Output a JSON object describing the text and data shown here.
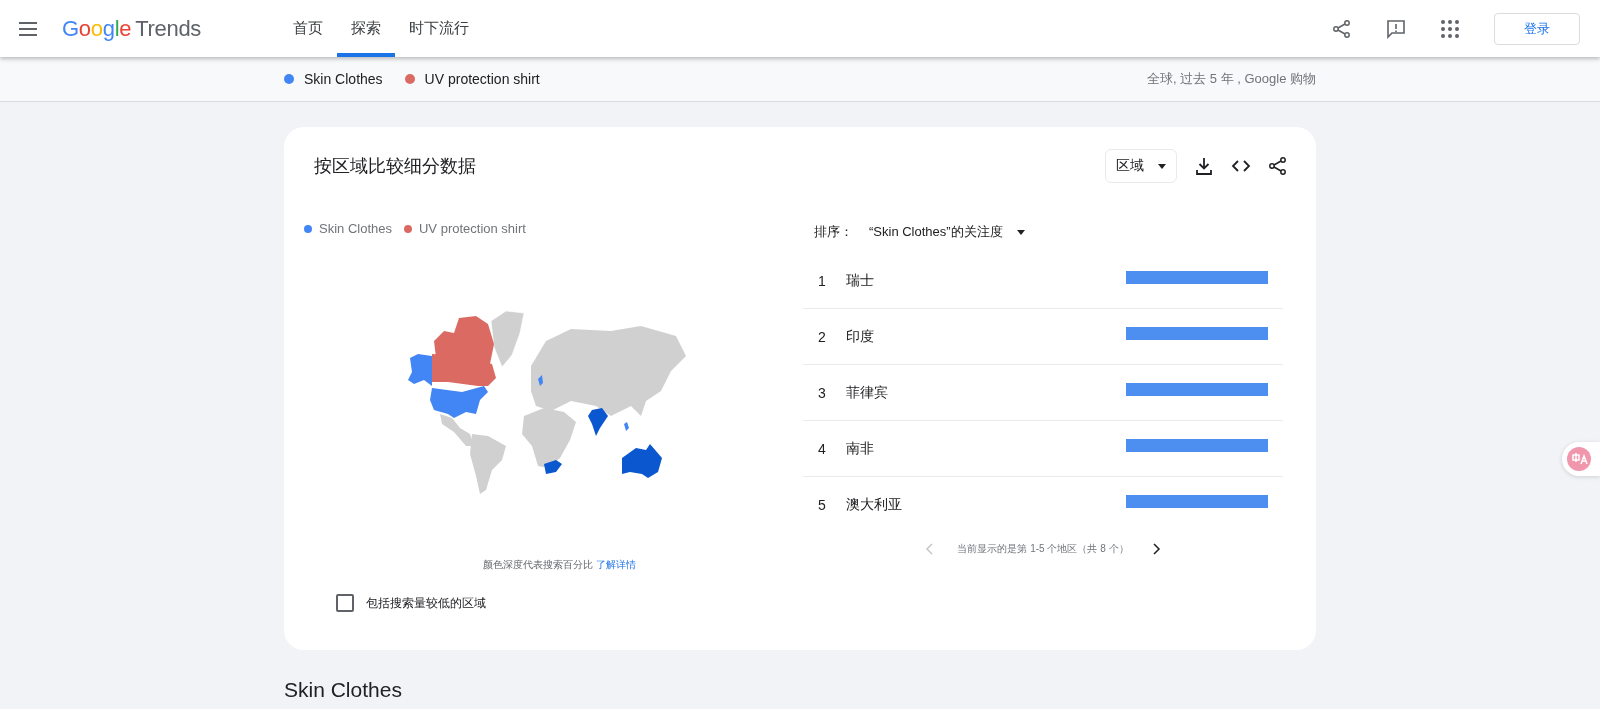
{
  "header": {
    "logo": {
      "brand": "Google",
      "product": "Trends"
    },
    "tabs": [
      {
        "label": "首页",
        "selected": false
      },
      {
        "label": "探索",
        "selected": true
      },
      {
        "label": "时下流行",
        "selected": false
      }
    ],
    "sign_in": "登录"
  },
  "compare_bar": {
    "terms": [
      {
        "label": "Skin Clothes",
        "color": "#4285f4"
      },
      {
        "label": "UV protection shirt",
        "color": "#db6b62"
      }
    ],
    "filters": "全球, 过去 5 年 , Google 购物"
  },
  "region_card": {
    "title": "按区域比较细分数据",
    "resolution": "区域",
    "legend": [
      {
        "label": "Skin Clothes",
        "color": "#4285f4"
      },
      {
        "label": "UV protection shirt",
        "color": "#db6b62"
      }
    ],
    "map_note": "颜色深度代表搜索百分比",
    "map_link": "了解详情",
    "low_volume": {
      "label": "包括搜索量较低的区域",
      "checked": false
    },
    "sort": {
      "label": "排序：",
      "value": "“Skin Clothes”的关注度"
    },
    "rows": [
      {
        "rank": "1",
        "name": "瑞士",
        "level": 1
      },
      {
        "rank": "2",
        "name": "印度",
        "level": 1
      },
      {
        "rank": "3",
        "name": "菲律宾",
        "level": 1
      },
      {
        "rank": "4",
        "name": "南非",
        "level": 1
      },
      {
        "rank": "5",
        "name": "澳大利亚",
        "level": 1
      }
    ],
    "pagination": {
      "text": "当前显示的是第 1-5 个地区（共 8 个）",
      "prev_disabled": true,
      "next_disabled": false
    }
  },
  "section_title": "Skin Clothes"
}
